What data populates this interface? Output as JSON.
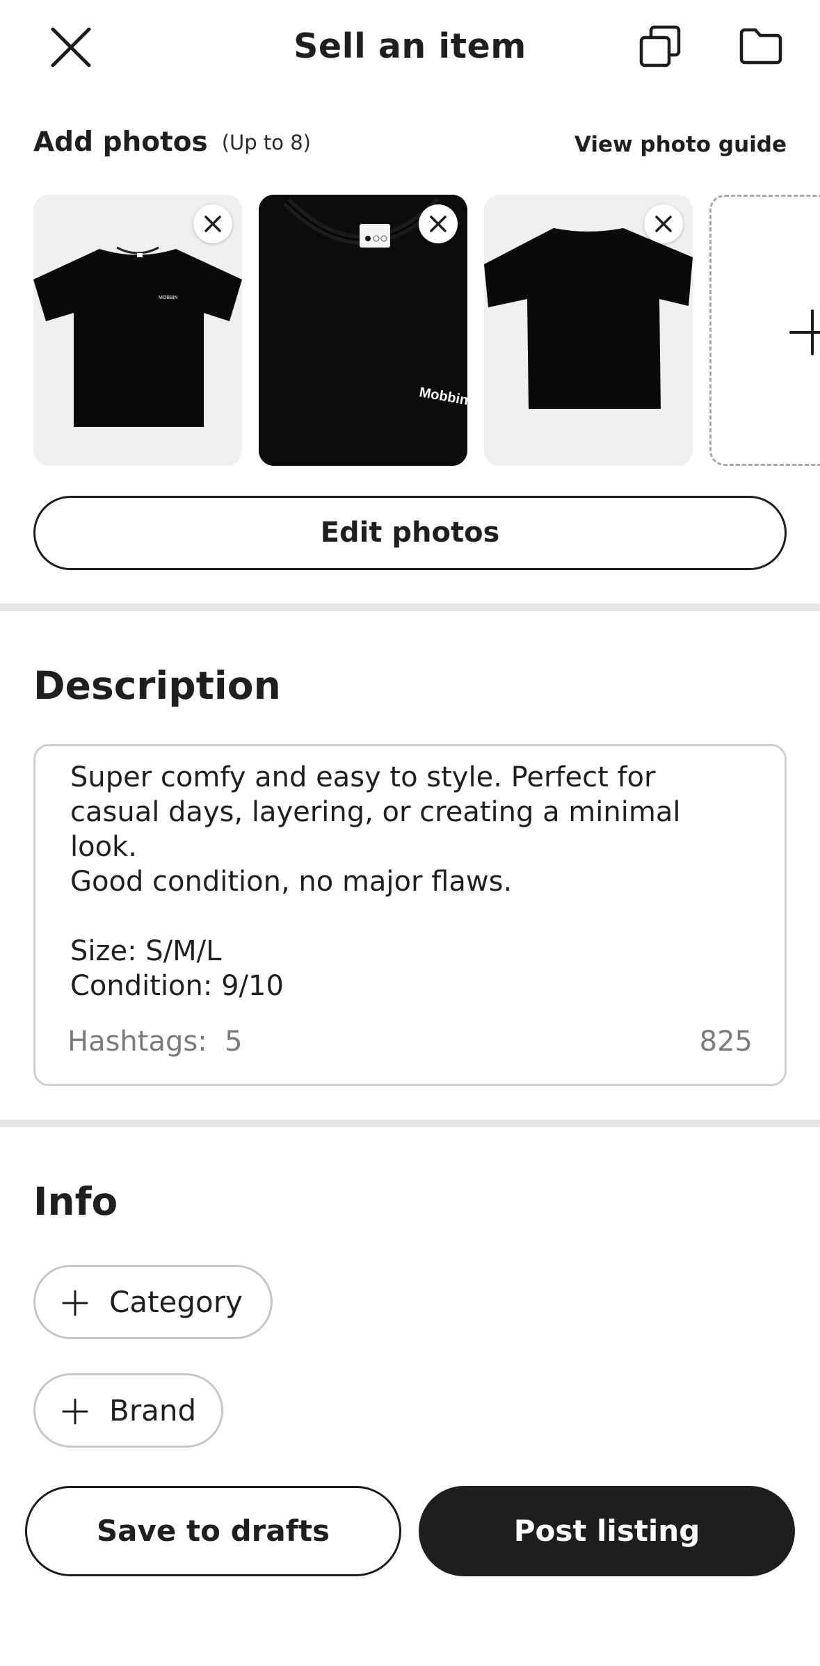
{
  "header": {
    "title": "Sell an item",
    "close_icon": "close-icon",
    "copy_icon": "copy-icon",
    "folder_icon": "folder-icon"
  },
  "photos": {
    "heading": "Add photos",
    "subheading": "(Up to 8)",
    "guide_link": "View photo guide",
    "items": [
      {
        "logo_text": "MOBBIN",
        "background": "#efefef"
      },
      {
        "logo_text": "Mobbin",
        "background": "#0c0c0c"
      },
      {
        "logo_text": "",
        "background": "#efefef"
      }
    ],
    "edit_button": "Edit photos"
  },
  "description": {
    "heading": "Description",
    "text": "Super comfy and easy to style. Perfect for\ncasual days, layering, or creating a minimal\nlook.\nGood condition, no major flaws.\n\nSize: S/M/L\nCondition: 9/10",
    "hashtags_label": "Hashtags:",
    "hashtags_count": "5",
    "char_count": "825"
  },
  "info": {
    "heading": "Info",
    "chips": [
      {
        "label": "Category",
        "icon": "plus-icon"
      },
      {
        "label": "Brand",
        "icon": "plus-icon"
      }
    ]
  },
  "actions": {
    "save_drafts": "Save to drafts",
    "post_listing": "Post listing"
  },
  "colors": {
    "primary": "#1e1e1e",
    "divider": "#e6e6e6",
    "border": "#cfcfcf"
  }
}
